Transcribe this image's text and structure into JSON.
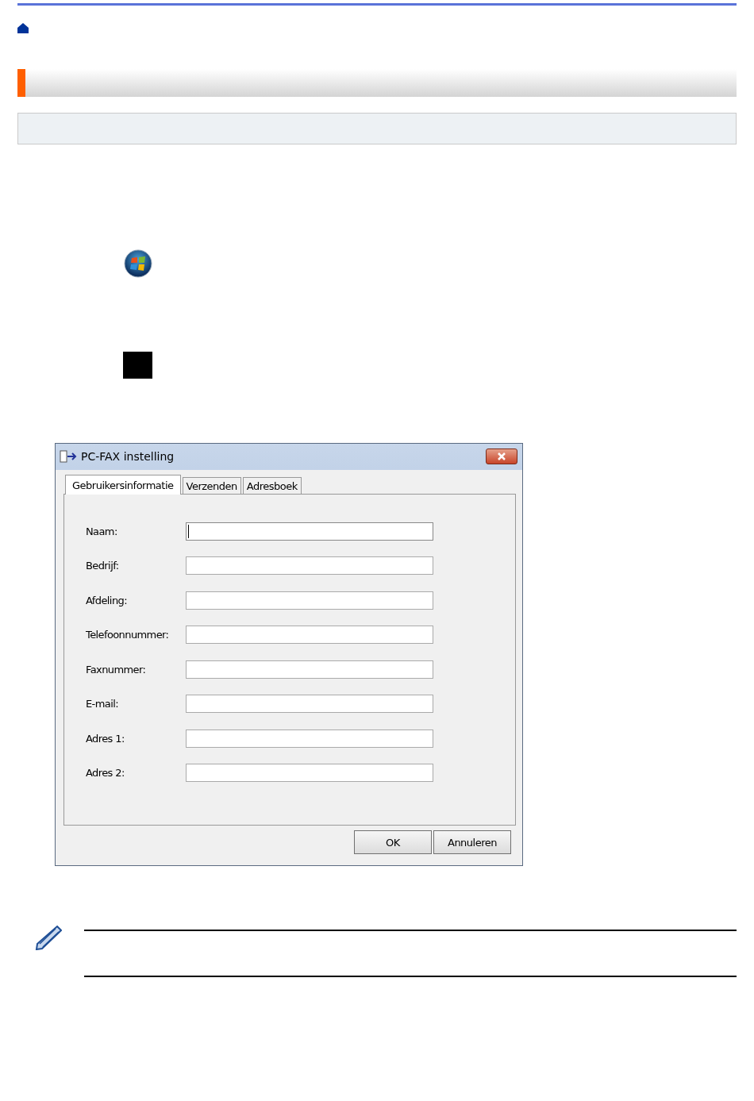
{
  "dialog": {
    "title": "PC-FAX instelling",
    "tabs": [
      {
        "label": "Gebruikersinformatie",
        "selected": true
      },
      {
        "label": "Verzenden",
        "selected": false
      },
      {
        "label": "Adresboek",
        "selected": false
      }
    ],
    "fields": [
      {
        "label": "Naam:",
        "focused": true
      },
      {
        "label": "Bedrijf:",
        "focused": false
      },
      {
        "label": "Afdeling:",
        "focused": false
      },
      {
        "label": "Telefoonnummer:",
        "focused": false
      },
      {
        "label": "Faxnummer:",
        "focused": false
      },
      {
        "label": "E-mail:",
        "focused": false
      },
      {
        "label": "Adres 1:",
        "focused": false
      },
      {
        "label": "Adres 2:",
        "focused": false
      }
    ],
    "buttons": [
      "OK",
      "Annuleren"
    ]
  }
}
